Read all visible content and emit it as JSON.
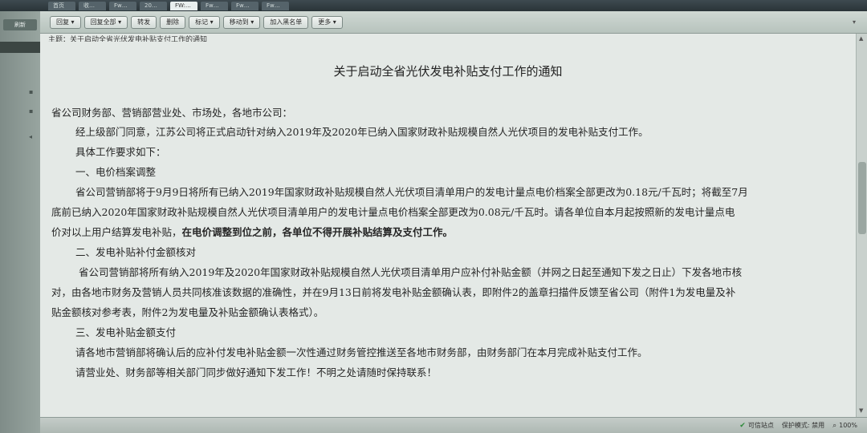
{
  "taskbar": {
    "tabs": [
      "首页",
      "收…",
      "Fw…",
      "20…",
      "FW:…",
      "Fw…",
      "Fw…",
      "Fw…"
    ]
  },
  "sidebar": {
    "button_label": "刷新"
  },
  "toolbar": {
    "buttons": [
      "回复 ▾",
      "回复全部 ▾",
      "转发",
      "删除",
      "标记 ▾",
      "移动到 ▾",
      "加入黑名单",
      "更多 ▾"
    ],
    "right_glyph": "▾"
  },
  "document": {
    "subject": "主题：关于启动全省光伏发电补贴支付工作的通知",
    "title": "关于启动全省光伏发电补贴支付工作的通知",
    "p1": "省公司财务部、营销部营业处、市场处，各地市公司：",
    "p2": "经上级部门同意，江苏公司将正式启动针对纳入2019年及2020年已纳入国家财政补贴规模自然人光伏项目的发电补贴支付工作。",
    "p3": "具体工作要求如下：",
    "h1": "一、电价档案调整",
    "p4a": "省公司营销部将于9月9日将所有已纳入2019年国家财政补贴规模自然人光伏项目清单用户的发电计量点电价档案全部更改为0.18元/千瓦时；将截至7月",
    "p4b": "底前已纳入2020年国家财政补贴规模自然人光伏项目清单用户的发电计量点电价档案全部更改为0.08元/千瓦时。请各单位自本月起按照新的发电计量点电",
    "p4c_normal": "价对以上用户结算发电补贴，",
    "p4c_bold": "在电价调整到位之前，各单位不得开展补贴结算及支付工作。",
    "h2": "二、发电补贴补付金额核对",
    "p5a": "省公司营销部将所有纳入2019年及2020年国家财政补贴规模自然人光伏项目清单用户应补付补贴金额（并网之日起至通知下发之日止）下发各地市核",
    "p5b": "对，由各地市财务及营销人员共同核准该数据的准确性，并在9月13日前将发电补贴金额确认表，即附件2的盖章扫描件反馈至省公司（附件1为发电量及补",
    "p5c": "贴金额核对参考表，附件2为发电量及补贴金额确认表格式）。",
    "h3": "三、发电补贴金额支付",
    "p6": "请各地市营销部将确认后的应补付发电补贴金额一次性通过财务管控推送至各地市财务部，由财务部门在本月完成补贴支付工作。",
    "p7": "请营业处、财务部等相关部门同步做好通知下发工作！不明之处请随时保持联系！"
  },
  "statusbar": {
    "site": "可信站点",
    "protected_mode": "保护模式: 禁用",
    "zoom": "100%"
  }
}
